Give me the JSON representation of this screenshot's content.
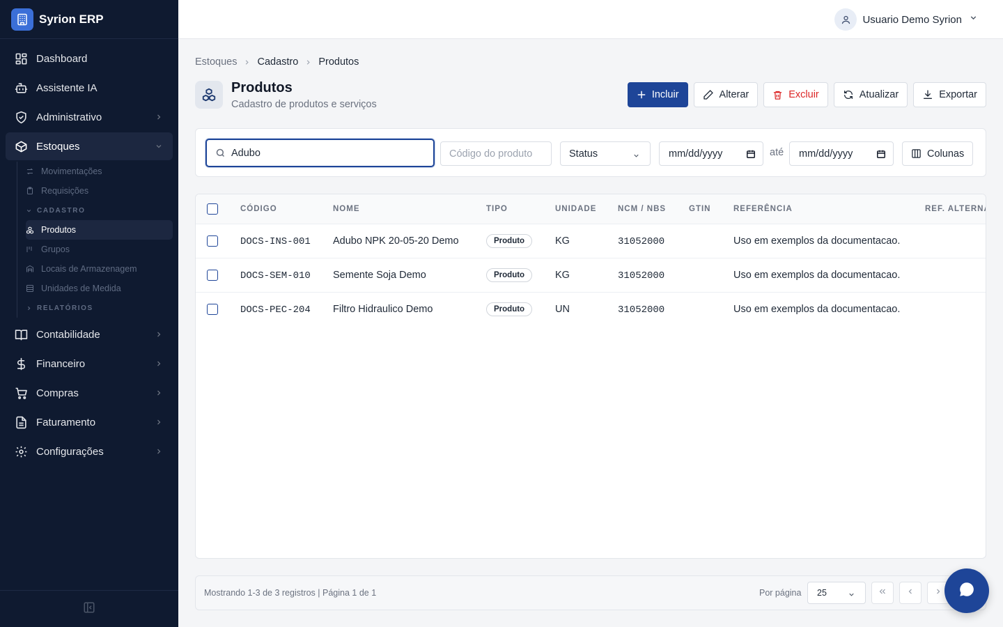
{
  "app": {
    "name": "Syrion ERP"
  },
  "user": {
    "name": "Usuario Demo Syrion"
  },
  "sidebar": {
    "items": [
      {
        "label": "Dashboard",
        "icon": "dashboard-icon"
      },
      {
        "label": "Assistente IA",
        "icon": "bot-icon"
      },
      {
        "label": "Administrativo",
        "icon": "shield-icon"
      },
      {
        "label": "Estoques",
        "icon": "package-icon"
      },
      {
        "label": "Contabilidade",
        "icon": "book-icon"
      },
      {
        "label": "Financeiro",
        "icon": "dollar-icon"
      },
      {
        "label": "Compras",
        "icon": "cart-icon"
      },
      {
        "label": "Faturamento",
        "icon": "file-icon"
      },
      {
        "label": "Configurações",
        "icon": "gear-icon"
      }
    ],
    "estoques_sub": {
      "movimentacoes": "Movimentações",
      "requisicoes": "Requisições",
      "section_cadastro": "CADASTRO",
      "produtos": "Produtos",
      "grupos": "Grupos",
      "locais": "Locais de Armazenagem",
      "unidades": "Unidades de Medida",
      "section_relatorios": "RELATÓRIOS"
    }
  },
  "breadcrumb": [
    "Estoques",
    "Cadastro",
    "Produtos"
  ],
  "page": {
    "title": "Produtos",
    "subtitle": "Cadastro de produtos e serviços"
  },
  "actions": {
    "incluir": "Incluir",
    "alterar": "Alterar",
    "excluir": "Excluir",
    "atualizar": "Atualizar",
    "exportar": "Exportar"
  },
  "filters": {
    "search_value": "Adubo",
    "code_placeholder": "Código do produto",
    "status": "Status",
    "date_from": "mm/dd/yyyy",
    "ate": "até",
    "date_to": "mm/dd/yyyy",
    "colunas": "Colunas"
  },
  "table": {
    "columns": [
      "CÓDIGO",
      "NOME",
      "TIPO",
      "UNIDADE",
      "NCM / NBS",
      "GTIN",
      "REFERÊNCIA",
      "REF. ALTERNA"
    ],
    "rows": [
      {
        "codigo": "DOCS-INS-001",
        "nome": "Adubo NPK 20-05-20 Demo",
        "tipo": "Produto",
        "unidade": "KG",
        "ncm": "31052000",
        "gtin": "",
        "referencia": "Uso em exemplos da documentacao."
      },
      {
        "codigo": "DOCS-SEM-010",
        "nome": "Semente Soja Demo",
        "tipo": "Produto",
        "unidade": "KG",
        "ncm": "31052000",
        "gtin": "",
        "referencia": "Uso em exemplos da documentacao."
      },
      {
        "codigo": "DOCS-PEC-204",
        "nome": "Filtro Hidraulico Demo",
        "tipo": "Produto",
        "unidade": "UN",
        "ncm": "31052000",
        "gtin": "",
        "referencia": "Uso em exemplos da documentacao."
      }
    ]
  },
  "footer": {
    "records": "Mostrando 1-3 de 3 registros | Página 1 de 1",
    "per_page_label": "Por página",
    "per_page": "25"
  },
  "colors": {
    "primary": "#1e4598",
    "sidebar_bg": "#0f1a30",
    "danger": "#dc2626"
  }
}
